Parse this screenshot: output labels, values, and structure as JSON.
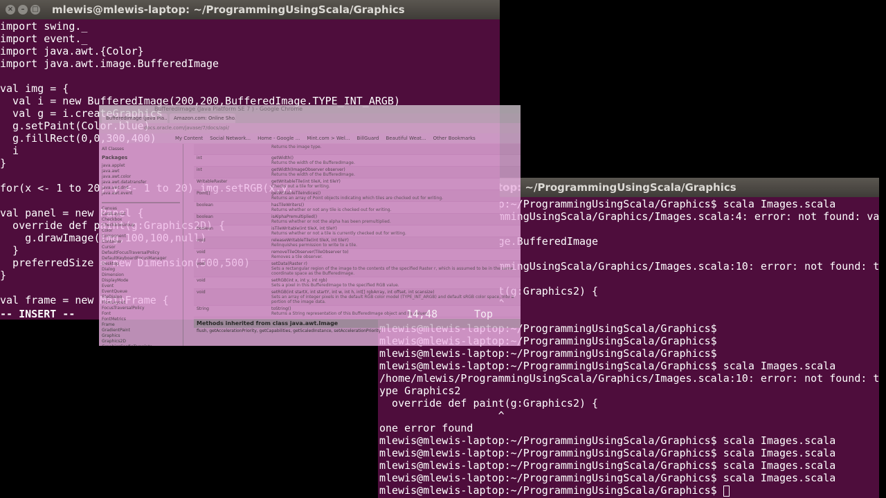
{
  "editor": {
    "title": "mlewis@mlewis-laptop: ~/ProgrammingUsingScala/Graphics",
    "lines": [
      "import swing._",
      "import event._",
      "import java.awt.{Color}",
      "import java.awt.image.BufferedImage",
      "",
      "val img = {",
      "  val i = new BufferedImage(200,200,BufferedImage.TYPE_INT_ARGB)",
      "  val g = i.createGraphics",
      "  g.setPaint(Color.blue)",
      "  g.fillRect(0,0,300,400)",
      "  i",
      "}",
      "",
      "for(x <- 1 to 20; y <- 1 to 20) img.setRGB(x,y,",
      "",
      "val panel = new Panel {",
      "  override def paint(g:Graphics2D) {",
      "    g.drawImage(img,100,100,null)",
      "  }",
      "  preferredSize = new Dimension(500,500)",
      "}",
      "",
      "val frame = new MainFrame {"
    ],
    "mode": "-- INSERT --",
    "position": "14,48",
    "scroll": "Top"
  },
  "terminal": {
    "title": "mlewis@mlewis-laptop: ~/ProgrammingUsingScala/Graphics",
    "lines": [
      "mlewis@mlewis-laptop:~/ProgrammingUsingScala/Graphics$ scala Images.scala",
      "/home/mlewis/ProgrammingUsingScala/Graphics/Images.scala:4: error: not found: va",
      "",
      "import java.awt.image.BufferedImage",
      "",
      "/home/mlewis/ProgrammingUsingScala/Graphics/Images.scala:10: error: not found: t",
      "",
      "  override def paint(g:Graphics2) {",
      "                   ^",
      "",
      "mlewis@mlewis-laptop:~/ProgrammingUsingScala/Graphics$",
      "mlewis@mlewis-laptop:~/ProgrammingUsingScala/Graphics$",
      "mlewis@mlewis-laptop:~/ProgrammingUsingScala/Graphics$",
      "mlewis@mlewis-laptop:~/ProgrammingUsingScala/Graphics$ scala Images.scala",
      "/home/mlewis/ProgrammingUsingScala/Graphics/Images.scala:10: error: not found: t",
      "ype Graphics2",
      "  override def paint(g:Graphics2) {",
      "                   ^",
      "one error found",
      "mlewis@mlewis-laptop:~/ProgrammingUsingScala/Graphics$ scala Images.scala",
      "mlewis@mlewis-laptop:~/ProgrammingUsingScala/Graphics$ scala Images.scala",
      "mlewis@mlewis-laptop:~/ProgrammingUsingScala/Graphics$ scala Images.scala",
      "mlewis@mlewis-laptop:~/ProgrammingUsingScala/Graphics$ scala Images.scala"
    ],
    "prompt": "mlewis@mlewis-laptop:~/ProgrammingUsingScala/Graphics$ "
  },
  "browser": {
    "title": "BufferedImage (Java Platform SE 7 ) - Google Chrome",
    "tabs": [
      "BufferedImage (Java Pla...",
      "Amazon.com: Online Sho..."
    ],
    "address": "docs.oracle.com/javase/7/docs/api/",
    "bookmarks": [
      "My Content",
      "Social Network...",
      "Home - Google ...",
      "Mint.com > Wel...",
      "BillGuard",
      "Beautiful Weat...",
      "Other Bookmarks"
    ],
    "packages_header": "All Classes",
    "packages_title": "Packages",
    "packages": [
      "java.applet",
      "java.awt",
      "java.awt.color",
      "java.awt.datatransfer",
      "java.awt.dnd",
      "java.awt.event"
    ],
    "classes": [
      "Canvas",
      "CardLayout",
      "Checkbox",
      "CheckboxGroup",
      "Color",
      "Component",
      "Container",
      "Cursor",
      "DefaultFocusTraversalPolicy",
      "DefaultKeyboardFocusManager",
      "Desktop",
      "Dialog",
      "Dimension",
      "DisplayMode",
      "Event",
      "EventQueue",
      "FileDialog",
      "FlowLayout",
      "FocusTraversalPolicy",
      "Font",
      "FontMetrics",
      "Frame",
      "GradientPaint",
      "Graphics",
      "Graphics2D",
      "GraphicsConfigTemplate",
      "GraphicsConfiguration",
      "GraphicsDevice",
      "GraphicsEnvironment"
    ],
    "methods": [
      {
        "type": "",
        "sig": "",
        "desc": "Returns the image type."
      },
      {
        "type": "int",
        "sig": "getWidth()",
        "desc": "Returns the width of the BufferedImage."
      },
      {
        "type": "int",
        "sig": "getWidth(ImageObserver observer)",
        "desc": "Returns the width of the BufferedImage."
      },
      {
        "type": "WritableRaster",
        "sig": "getWritableTile(int tileX, int tileY)",
        "desc": "Checks out a tile for writing."
      },
      {
        "type": "Point[]",
        "sig": "getWritableTileIndices()",
        "desc": "Returns an array of Point objects indicating which tiles are checked out for writing."
      },
      {
        "type": "boolean",
        "sig": "hasTileWriters()",
        "desc": "Returns whether or not any tile is checked out for writing."
      },
      {
        "type": "boolean",
        "sig": "isAlphaPremultiplied()",
        "desc": "Returns whether or not the alpha has been premultiplied."
      },
      {
        "type": "boolean",
        "sig": "isTileWritable(int tileX, int tileY)",
        "desc": "Returns whether or not a tile is currently checked out for writing."
      },
      {
        "type": "void",
        "sig": "releaseWritableTile(int tileX, int tileY)",
        "desc": "Relinquishes permission to write to a tile."
      },
      {
        "type": "void",
        "sig": "removeTileObserver(TileObserver to)",
        "desc": "Removes a tile observer."
      },
      {
        "type": "void",
        "sig": "setData(Raster r)",
        "desc": "Sets a rectangular region of the image to the contents of the specified Raster r, which is assumed to be in the same coordinate space as the BufferedImage."
      },
      {
        "type": "void",
        "sig": "setRGB(int x, int y, int rgb)",
        "desc": "Sets a pixel in this BufferedImage to the specified RGB value."
      },
      {
        "type": "void",
        "sig": "setRGB(int startX, int startY, int w, int h, int[] rgbArray, int offset, int scansize)",
        "desc": "Sets an array of integer pixels in the default RGB color model (TYPE_INT_ARGB) and default sRGB color space, into a portion of the image data."
      },
      {
        "type": "String",
        "sig": "toString()",
        "desc": "Returns a String representation of this BufferedImage object and its values."
      }
    ],
    "inherited": "Methods inherited from class java.awt.Image",
    "inherited_list": "flush, getAccelerationPriority, getCapabilities, getScaledInstance, setAccelerationPriority"
  },
  "colors": {
    "terminal_bg": "#4e0d3c",
    "browser_tint": "#f0b6e8"
  }
}
